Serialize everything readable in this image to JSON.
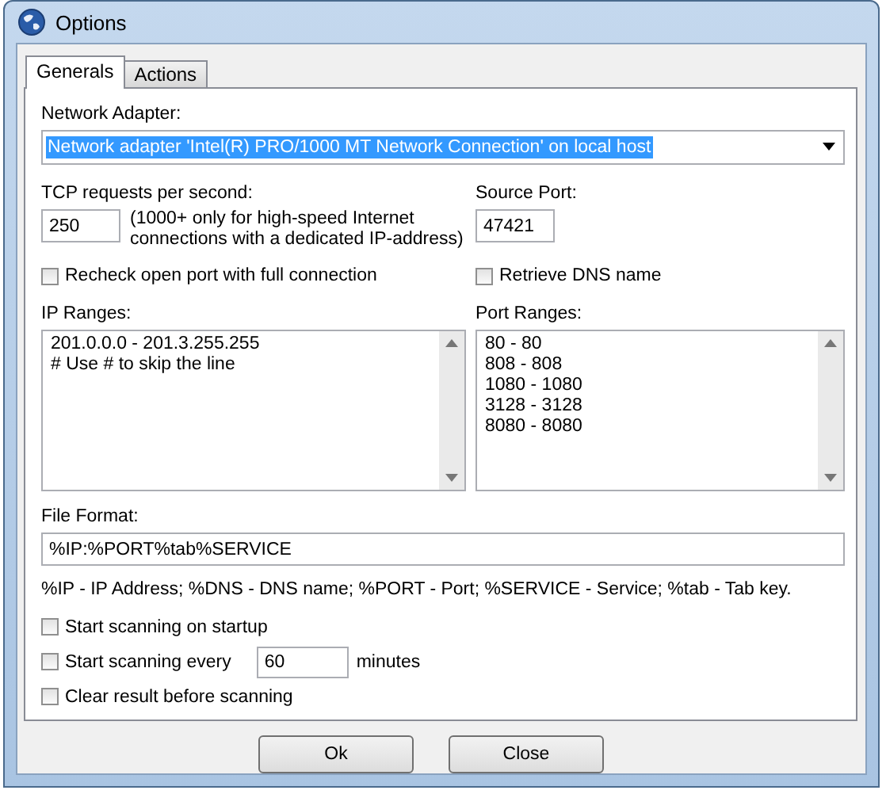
{
  "window": {
    "title": "Options"
  },
  "tabs": [
    {
      "label": "Generals",
      "selected": true
    },
    {
      "label": "Actions",
      "selected": false
    }
  ],
  "network_adapter": {
    "label": "Network Adapter:",
    "value": "Network adapter 'Intel(R) PRO/1000 MT Network Connection' on local host",
    "focused": true
  },
  "tcp_requests": {
    "label": "TCP requests per second:",
    "value": "250",
    "hint": "(1000+ only for high-speed Internet connections with a dedicated IP-address)"
  },
  "source_port": {
    "label": "Source Port:",
    "value": "47421"
  },
  "recheck": {
    "label": "Recheck open port with full connection",
    "checked": false
  },
  "retrieve_dns": {
    "label": "Retrieve DNS name",
    "checked": false
  },
  "ip_ranges": {
    "label": "IP Ranges:",
    "lines": [
      "201.0.0.0 - 201.3.255.255",
      "# Use # to skip the line"
    ]
  },
  "port_ranges": {
    "label": "Port Ranges:",
    "lines": [
      "80 - 80",
      "808 - 808",
      "1080 - 1080",
      "3128 - 3128",
      "8080 - 8080"
    ]
  },
  "file_format": {
    "label": "File Format:",
    "value": "%IP:%PORT%tab%SERVICE",
    "legend": "%IP - IP Address; %DNS - DNS name; %PORT - Port; %SERVICE - Service; %tab - Tab key."
  },
  "scan_options": [
    {
      "kind": "checkbox",
      "label": "Start scanning on startup",
      "checked": false
    },
    {
      "kind": "interval",
      "label": "Start scanning every",
      "checked": false,
      "value": "60",
      "unit": "minutes"
    },
    {
      "kind": "checkbox",
      "label": "Clear result before scanning",
      "checked": false
    }
  ],
  "buttons": [
    "Ok",
    "Close"
  ]
}
